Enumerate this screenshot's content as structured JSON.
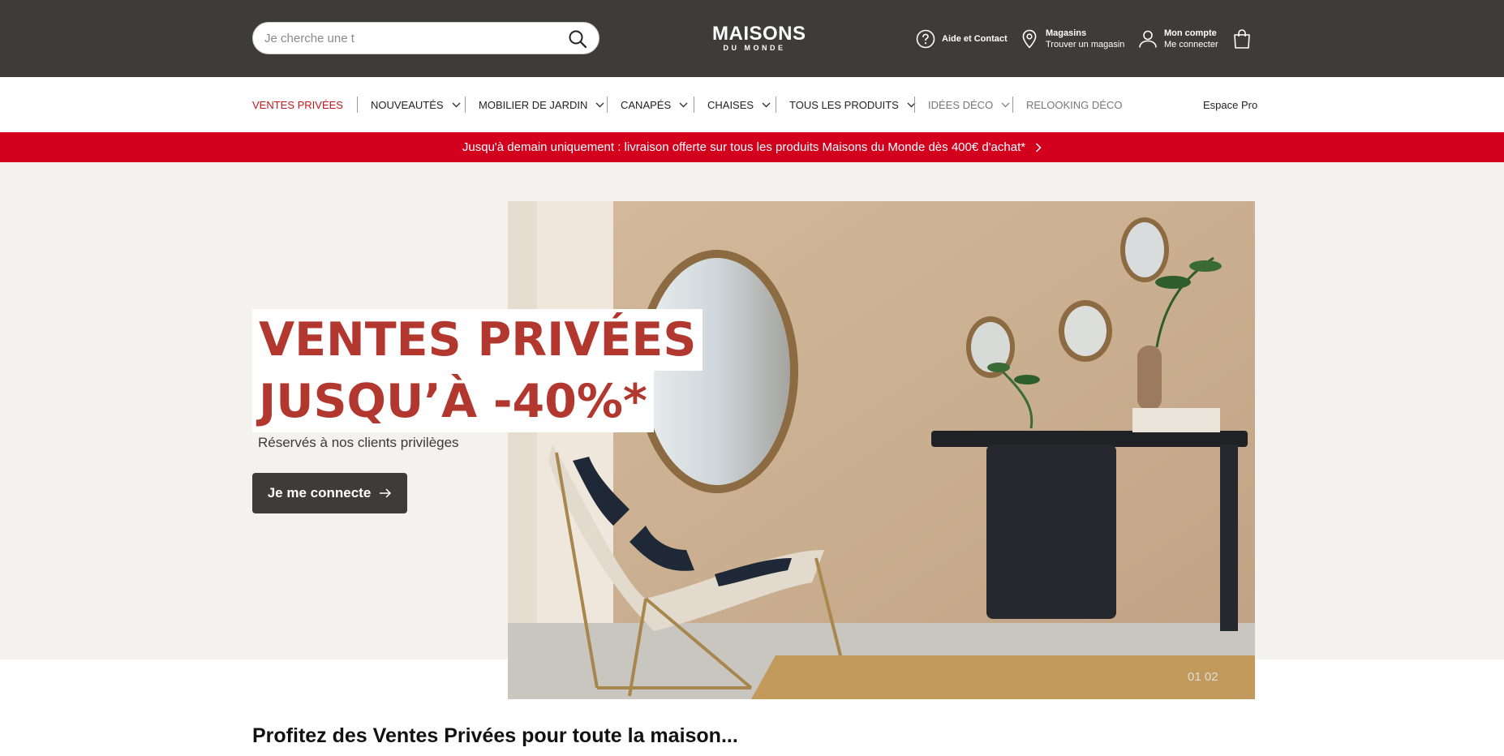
{
  "header": {
    "search_placeholder": "Je cherche une t",
    "logo_line1": "MAISONS",
    "logo_line2": "DU MONDE",
    "help_label": "Aide et Contact",
    "stores_title": "Magasins",
    "stores_sub": "Trouver un magasin",
    "account_title": "Mon compte",
    "account_sub": "Me connecter"
  },
  "nav": {
    "items": [
      {
        "label": "VENTES PRIVÉES"
      },
      {
        "label": "NOUVEAUTÉS"
      },
      {
        "label": "MOBILIER DE JARDIN"
      },
      {
        "label": "CANAPÉS"
      },
      {
        "label": "CHAISES"
      },
      {
        "label": "TOUS LES PRODUITS"
      },
      {
        "label": "IDÉES DÉCO"
      },
      {
        "label": "RELOOKING DÉCO"
      }
    ],
    "espace_pro": "Espace Pro"
  },
  "promo": {
    "text": "Jusqu'à demain uniquement : livraison offerte sur tous les produits Maisons du Monde dès 400€ d'achat*"
  },
  "hero": {
    "title_line1": "VENTES PRIVÉES",
    "title_line2": "JUSQU’À -40%*",
    "subtitle": "Réservés à nos clients privilèges",
    "cta_label": "Je me connecte",
    "slide_counter": "01  02"
  },
  "section": {
    "title": "Profitez des Ventes Privées pour toute la maison..."
  },
  "colors": {
    "topbar": "#3d3c3a",
    "accent_red": "#d2001c",
    "title_red": "#b2372e",
    "nav_active": "#c4161c",
    "hero_bg": "#f4f2ef"
  }
}
